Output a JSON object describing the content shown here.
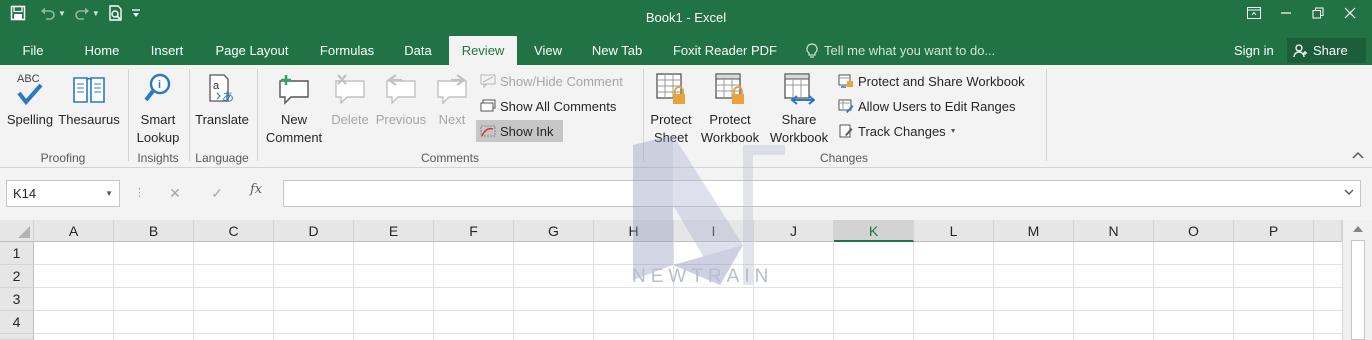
{
  "window": {
    "title": "Book1 - Excel"
  },
  "tabs": [
    {
      "label": "File"
    },
    {
      "label": "Home"
    },
    {
      "label": "Insert"
    },
    {
      "label": "Page Layout"
    },
    {
      "label": "Formulas"
    },
    {
      "label": "Data"
    },
    {
      "label": "Review",
      "active": true
    },
    {
      "label": "View"
    },
    {
      "label": "New Tab"
    },
    {
      "label": "Foxit Reader PDF"
    }
  ],
  "tell_me": {
    "placeholder": "Tell me what you want to do..."
  },
  "account": {
    "sign_in": "Sign in",
    "share": "Share"
  },
  "ribbon": {
    "proofing": {
      "label": "Proofing",
      "spelling": "Spelling",
      "thesaurus": "Thesaurus",
      "spelling_icon_text": "ABC"
    },
    "insights": {
      "label": "Insights",
      "smart_lookup_1": "Smart",
      "smart_lookup_2": "Lookup"
    },
    "language": {
      "label": "Language",
      "translate": "Translate"
    },
    "comments": {
      "label": "Comments",
      "new_comment_1": "New",
      "new_comment_2": "Comment",
      "delete": "Delete",
      "previous": "Previous",
      "next": "Next",
      "show_hide": "Show/Hide Comment",
      "show_all": "Show All Comments",
      "show_ink": "Show Ink"
    },
    "changes": {
      "label": "Changes",
      "protect_sheet_1": "Protect",
      "protect_sheet_2": "Sheet",
      "protect_workbook_1": "Protect",
      "protect_workbook_2": "Workbook",
      "share_workbook_1": "Share",
      "share_workbook_2": "Workbook",
      "protect_and_share": "Protect and Share Workbook",
      "allow_users": "Allow Users to Edit Ranges",
      "track_changes": "Track Changes"
    }
  },
  "formula_bar": {
    "name_box": "K14",
    "fx": "fx",
    "value": ""
  },
  "sheet": {
    "columns": [
      "A",
      "B",
      "C",
      "D",
      "E",
      "F",
      "G",
      "H",
      "I",
      "J",
      "K",
      "L",
      "M",
      "N",
      "O",
      "P"
    ],
    "active_column": "K",
    "rows": [
      "1",
      "2",
      "3",
      "4"
    ]
  },
  "watermark": {
    "text": "NEWTRAIN"
  },
  "colors": {
    "accent": "#217346",
    "ribbon_bg": "#f3f3f3",
    "header_bg": "#e6e6e6"
  }
}
